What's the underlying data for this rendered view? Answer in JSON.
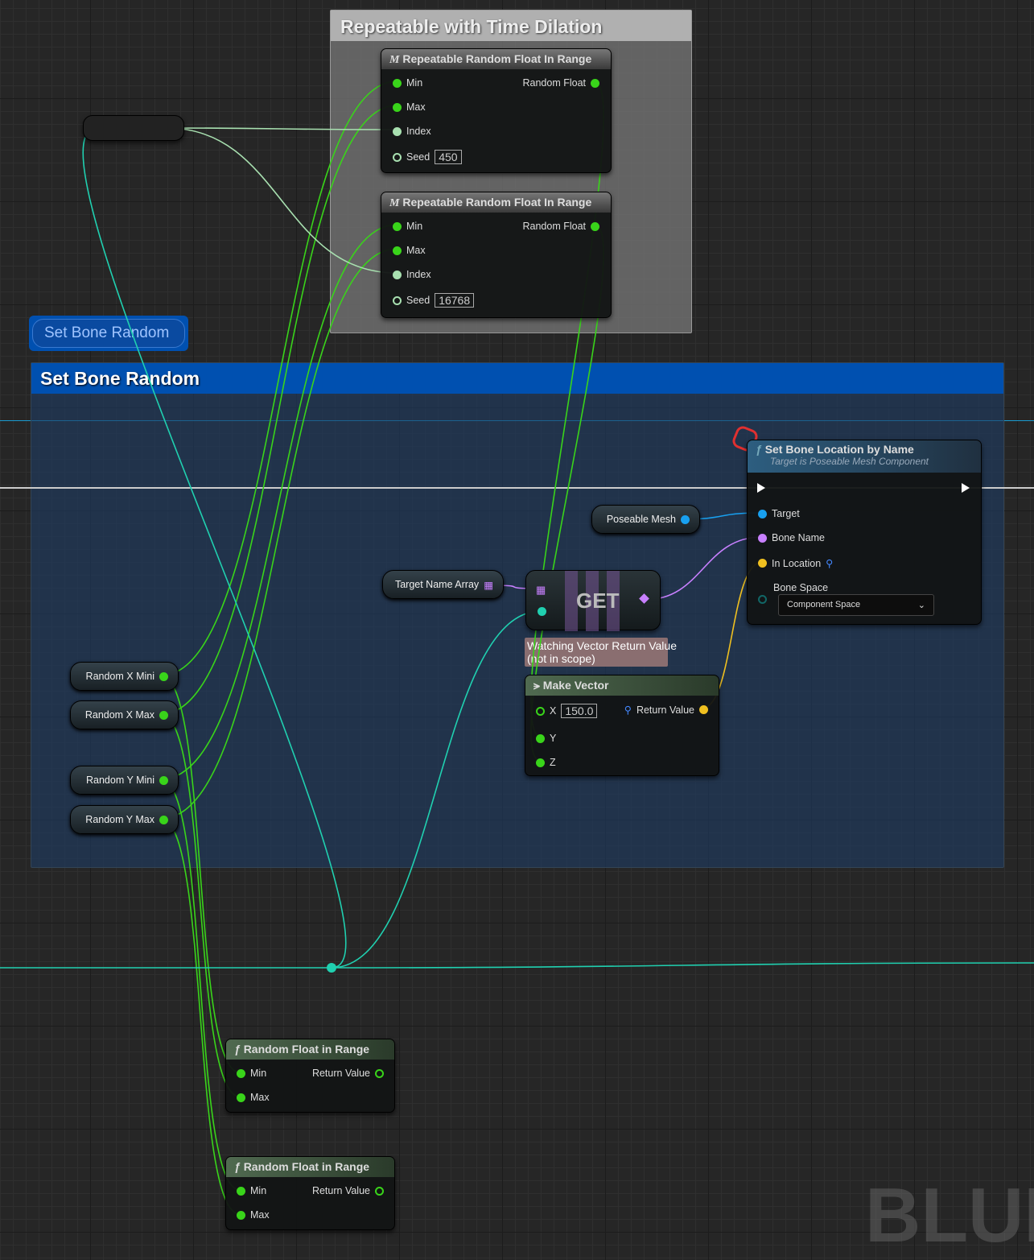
{
  "comments": {
    "time_dilation": "Repeatable with Time Dilation",
    "set_bone_random": "Set Bone Random",
    "bubble": "Set Bone Random"
  },
  "rrfir": [
    {
      "title": "Repeatable Random Float In Range",
      "min": "Min",
      "max": "Max",
      "index": "Index",
      "seed": "Seed",
      "seed_value": "450",
      "out": "Random Float"
    },
    {
      "title": "Repeatable Random Float In Range",
      "min": "Min",
      "max": "Max",
      "index": "Index",
      "seed": "Seed",
      "seed_value": "16768",
      "out": "Random Float"
    }
  ],
  "set_bone": {
    "title": "Set Bone Location by Name",
    "subtitle": "Target is Poseable Mesh Component",
    "target": "Target",
    "bone_name": "Bone Name",
    "in_location": "In Location",
    "bone_space": "Bone Space",
    "bone_space_value": "Component Space"
  },
  "poseable_mesh": "Poseable Mesh",
  "target_name_array": "Target Name Array",
  "get": "GET",
  "watch": "Watching Vector Return Value\n(not in scope)",
  "make_vector": {
    "title": "Make Vector",
    "x": "X",
    "x_value": "150.0",
    "y": "Y",
    "z": "Z",
    "out": "Return Value"
  },
  "vars": [
    "Random X Mini",
    "Random X Max",
    "Random Y Mini",
    "Random Y Max"
  ],
  "rfir": [
    {
      "title": "Random Float in Range",
      "min": "Min",
      "max": "Max",
      "out": "Return Value"
    },
    {
      "title": "Random Float in Range",
      "min": "Min",
      "max": "Max",
      "out": "Return Value"
    }
  ],
  "watermark": "BLUEPRINT",
  "colors": {
    "float": "#39d41a",
    "int": "#a8e0b0",
    "object": "#18a0f0",
    "name": "#c880ff",
    "vector": "#f0c020",
    "exec": "#ffffff",
    "struct": "#20d0b0"
  }
}
